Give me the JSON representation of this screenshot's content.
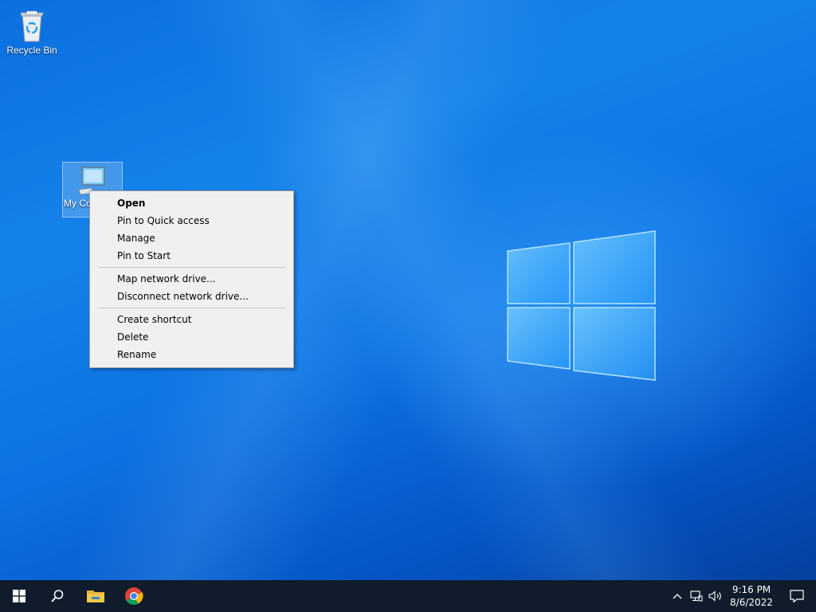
{
  "desktop": {
    "icons": [
      {
        "label": "Recycle Bin",
        "icon": "recycle-bin-icon"
      },
      {
        "label": "My Computer",
        "icon": "computer-icon"
      }
    ]
  },
  "context_menu": {
    "groups": [
      [
        "Open",
        "Pin to Quick access",
        "Manage",
        "Pin to Start"
      ],
      [
        "Map network drive...",
        "Disconnect network drive..."
      ],
      [
        "Create shortcut",
        "Delete",
        "Rename"
      ]
    ],
    "default_item": "Open"
  },
  "taskbar": {
    "buttons": [
      "windows-start-icon",
      "search-icon",
      "file-explorer-icon",
      "chrome-icon"
    ],
    "tray": [
      "chevron-up-icon",
      "network-icon",
      "volume-icon"
    ],
    "clock": {
      "time": "9:16 PM",
      "date": "8/6/2022"
    },
    "notification_icon": "action-center-icon"
  },
  "colors": {
    "taskbar_bg": "#101c2c",
    "menu_bg": "#f0f0f0",
    "desktop_blue": "#0a63d6"
  }
}
